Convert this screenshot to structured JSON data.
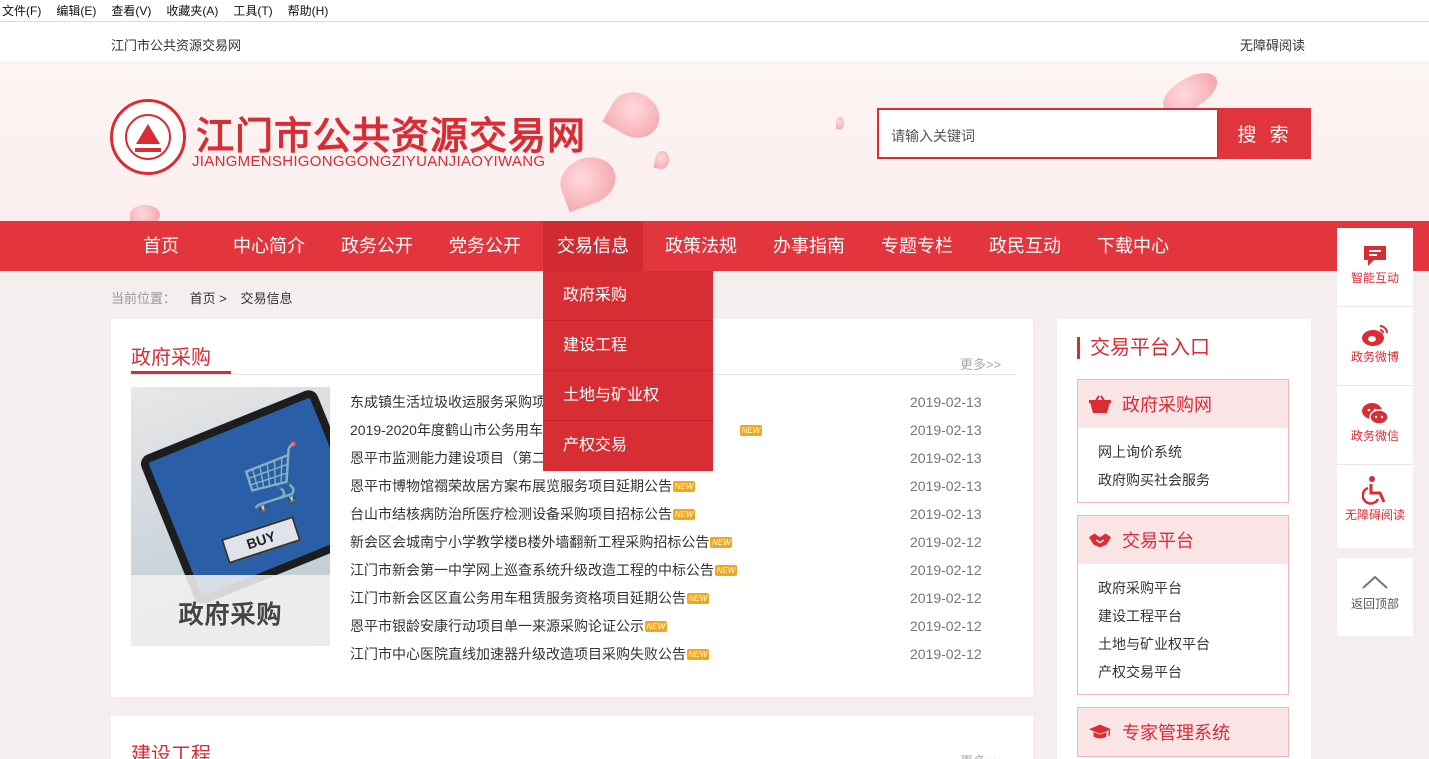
{
  "browser_menu": [
    "文件(F)",
    "编辑(E)",
    "查看(V)",
    "收藏夹(A)",
    "工具(T)",
    "帮助(H)"
  ],
  "topbar": {
    "site_name": "江门市公共资源交易网",
    "accessibility": "无障碍阅读"
  },
  "header": {
    "logo_title": "江门市公共资源交易网",
    "logo_subtitle": "JIANGMENSHIGONGGONGZIYUANJIAOYIWANG",
    "search_placeholder": "请输入关键词",
    "search_button": "搜 索"
  },
  "nav": {
    "items": [
      "首页",
      "中心简介",
      "政务公开",
      "党务公开",
      "交易信息",
      "政策法规",
      "办事指南",
      "专题专栏",
      "政民互动",
      "下载中心"
    ],
    "active_index": 4,
    "dropdown": [
      "政府采购",
      "建设工程",
      "土地与矿业权",
      "产权交易"
    ]
  },
  "breadcrumb": {
    "label": "当前位置：",
    "home": "首页 >",
    "current": "交易信息"
  },
  "section_gov": {
    "title": "政府采购",
    "more": "更多>>",
    "promo_text": "政府采购",
    "promo_buy": "BUY",
    "new_label": "NEW",
    "items": [
      {
        "title": "东成镇生活垃圾收运服务采购项",
        "date": "2019-02-13",
        "new": false
      },
      {
        "title": "2019-2020年度鹤山市公务用车",
        "date": "2019-02-13",
        "new": true
      },
      {
        "title": "恩平市监测能力建设项目（第二",
        "date": "2019-02-13",
        "new": false
      },
      {
        "title": "恩平市博物馆禤荣故居方案布展览服务项目延期公告",
        "date": "2019-02-13",
        "new": true
      },
      {
        "title": "台山市结核病防治所医疗检测设备采购项目招标公告",
        "date": "2019-02-13",
        "new": true
      },
      {
        "title": "新会区会城南宁小学教学楼B楼外墙翻新工程采购招标公告",
        "date": "2019-02-12",
        "new": true
      },
      {
        "title": "江门市新会第一中学网上巡查系统升级改造工程的中标公告",
        "date": "2019-02-12",
        "new": true
      },
      {
        "title": "江门市新会区区直公务用车租赁服务资格项目延期公告",
        "date": "2019-02-12",
        "new": true
      },
      {
        "title": "恩平市银龄安康行动项目单一来源采购论证公示",
        "date": "2019-02-12",
        "new": true
      },
      {
        "title": "江门市中心医院直线加速器升级改造项目采购失败公告",
        "date": "2019-02-12",
        "new": true
      }
    ]
  },
  "section_build": {
    "title": "建设工程",
    "more": "更多>>"
  },
  "sidebar": {
    "title": "交易平台入口",
    "boxes": [
      {
        "title": "政府采购网",
        "icon": "basket-icon",
        "links": [
          "网上询价系统",
          "政府购买社会服务"
        ]
      },
      {
        "title": "交易平台",
        "icon": "handshake-icon",
        "links": [
          "政府采购平台",
          "建设工程平台",
          "土地与矿业权平台",
          "产权交易平台"
        ]
      },
      {
        "title": "专家管理系统",
        "icon": "graduation-cap-icon",
        "links": []
      }
    ]
  },
  "float_toolbar": [
    {
      "label": "智能互动",
      "icon": "chat-icon"
    },
    {
      "label": "政务微博",
      "icon": "weibo-icon"
    },
    {
      "label": "政务微信",
      "icon": "wechat-icon"
    },
    {
      "label": "无障碍阅读",
      "icon": "wheelchair-icon"
    },
    {
      "label": "返回顶部",
      "icon": "chevron-up-icon"
    }
  ],
  "colors": {
    "brand_red": "#e3353e",
    "dark_red": "#d12a33",
    "new_badge": "#f3a61a"
  }
}
